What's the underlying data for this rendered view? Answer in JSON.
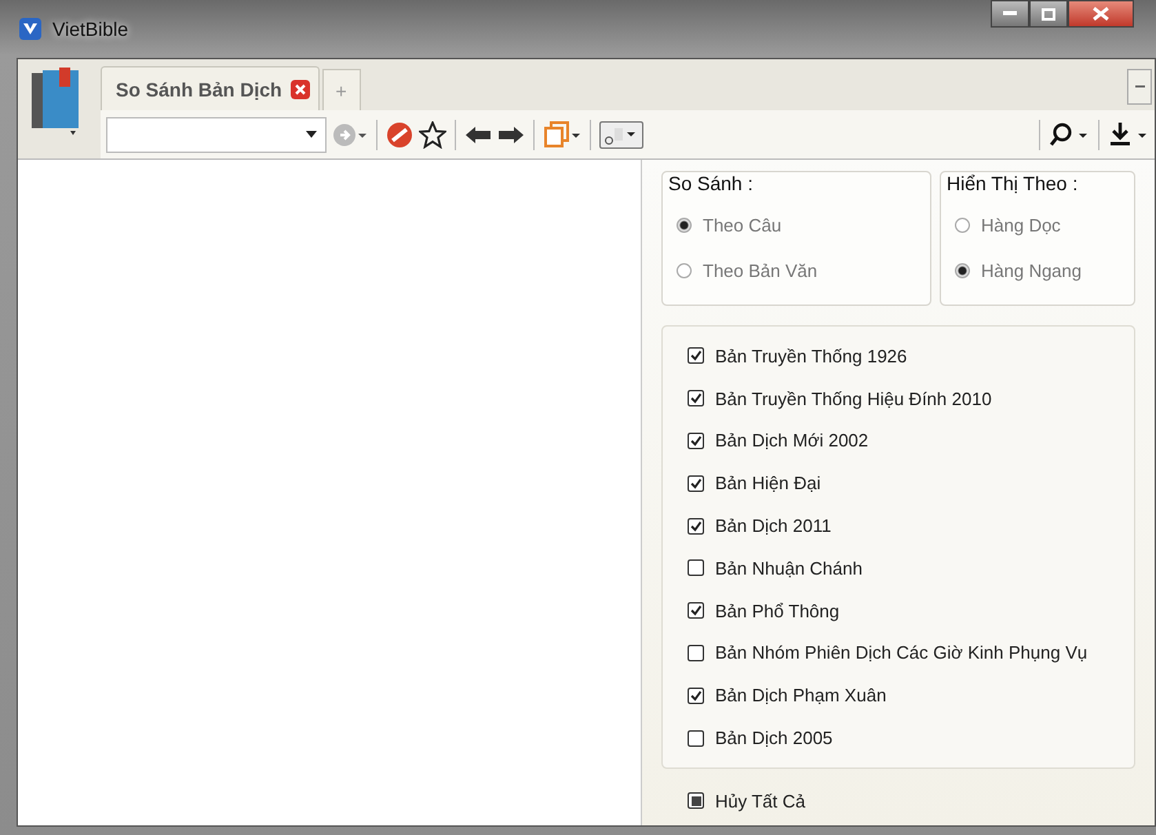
{
  "window": {
    "title": "VietBible"
  },
  "tabs": [
    {
      "label": "So Sánh Bản Dịch",
      "selected": true
    }
  ],
  "new_tab": {
    "label": "+"
  },
  "compare_panel": {
    "groups": [
      {
        "title": "So Sánh :",
        "options": [
          {
            "label": "Theo Câu",
            "selected": true
          },
          {
            "label": "Theo Bản Văn",
            "selected": false
          }
        ]
      },
      {
        "title": "Hiển Thị Theo :",
        "options": [
          {
            "label": "Hàng Dọc",
            "selected": false
          },
          {
            "label": "Hàng Ngang",
            "selected": true
          }
        ]
      }
    ],
    "versions": [
      {
        "label": "Bản Truyền Thống 1926",
        "checked": true
      },
      {
        "label": "Bản Truyền Thống Hiệu Đính 2010",
        "checked": true
      },
      {
        "label": "Bản Dịch Mới 2002",
        "checked": true
      },
      {
        "label": "Bản Hiện Đại",
        "checked": true
      },
      {
        "label": "Bản Dịch 2011",
        "checked": true
      },
      {
        "label": "Bản Nhuận Chánh",
        "checked": false
      },
      {
        "label": "Bản Phổ Thông",
        "checked": true
      },
      {
        "label": "Bản Nhóm Phiên Dịch Các Giờ Kinh Phụng Vụ",
        "checked": false
      },
      {
        "label": "Bản Dịch Phạm Xuân",
        "checked": true
      },
      {
        "label": "Bản Dịch 2005",
        "checked": false
      }
    ],
    "toggle_all": {
      "label": "Hủy Tất Cả",
      "partial": true
    }
  }
}
